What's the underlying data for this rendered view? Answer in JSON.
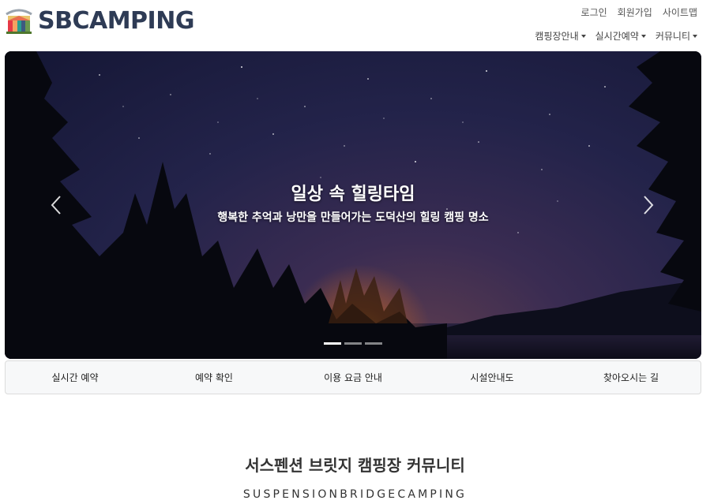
{
  "brand": {
    "name": "SBCAMPING",
    "logo_icon": "camping-logo-icon"
  },
  "top_links": {
    "login": "로그인",
    "signup": "회원가입",
    "sitemap": "사이트맵"
  },
  "nav": {
    "items": [
      {
        "label": "캠핑장안내"
      },
      {
        "label": "실시간예약"
      },
      {
        "label": "커뮤니티"
      }
    ]
  },
  "hero": {
    "title": "일상 속 힐링타임",
    "subtitle": "행복한 추억과 낭만을 만들어가는 도덕산의 힐링 캠핑 명소",
    "prev_icon": "chevron-left-icon",
    "next_icon": "chevron-right-icon",
    "slide_count": 3,
    "active_slide": 1
  },
  "quick_menu": {
    "items": [
      "실시간 예약",
      "예약 확인",
      "이용 요금 안내",
      "시설안내도",
      "찾아오시는 길"
    ]
  },
  "community": {
    "title": "서스펜션 브릿지 캠핑장 커뮤니티",
    "subtitle": "SUSPENSIONBRIDGECAMPING"
  },
  "colors": {
    "brand_text": "#2e3b55",
    "night_sky": "#23234a",
    "quick_menu_bg": "#f7f8f9"
  }
}
